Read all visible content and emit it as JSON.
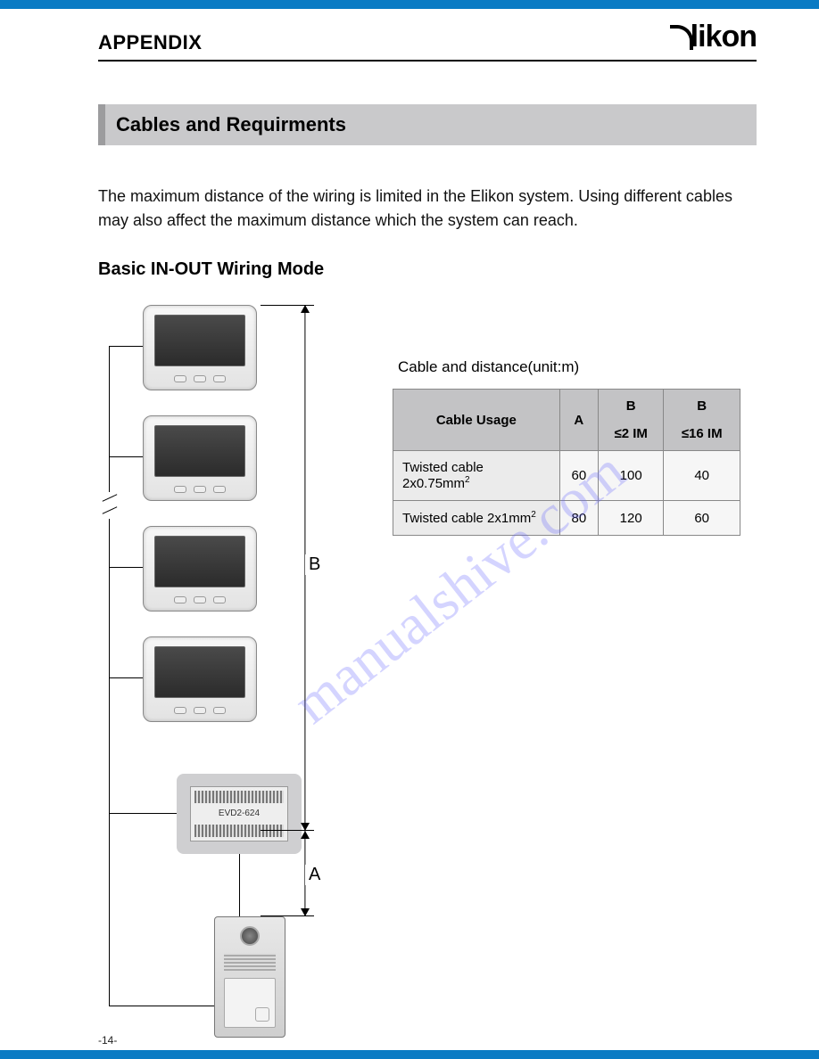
{
  "header": {
    "title": "APPENDIX",
    "brand": "likon"
  },
  "section": {
    "title": "Cables and Requirments",
    "paragraph": "The maximum distance of the wiring is limited in the Elikon system. Using different cables may also affect the maximum distance which the system can reach."
  },
  "subsection": {
    "title": "Basic IN-OUT  Wiring Mode"
  },
  "diagram": {
    "dim_a_label": "A",
    "dim_b_label": "B",
    "evd_label": "EVD2-624"
  },
  "table": {
    "caption": "Cable and distance(unit:m)",
    "headers": {
      "usage": "Cable Usage",
      "a": "A",
      "b1_line1": "B",
      "b1_line2": "≤2 IM",
      "b2_line1": "B",
      "b2_line2": "≤16 IM"
    },
    "rows": [
      {
        "usage": "Twisted cable 2x0.75mm",
        "sup": "2",
        "a": "60",
        "b1": "100",
        "b2": "40"
      },
      {
        "usage": "Twisted cable 2x1mm",
        "sup": "2",
        "a": "80",
        "b1": "120",
        "b2": "60"
      }
    ]
  },
  "chart_data": {
    "type": "table",
    "title": "Cable and distance(unit:m)",
    "columns": [
      "Cable Usage",
      "A",
      "B ≤2 IM",
      "B ≤16 IM"
    ],
    "rows": [
      [
        "Twisted cable 2x0.75mm²",
        60,
        100,
        40
      ],
      [
        "Twisted cable 2x1mm²",
        80,
        120,
        60
      ]
    ],
    "unit": "m"
  },
  "watermark": "manualshive.com",
  "page_number": "-14-"
}
